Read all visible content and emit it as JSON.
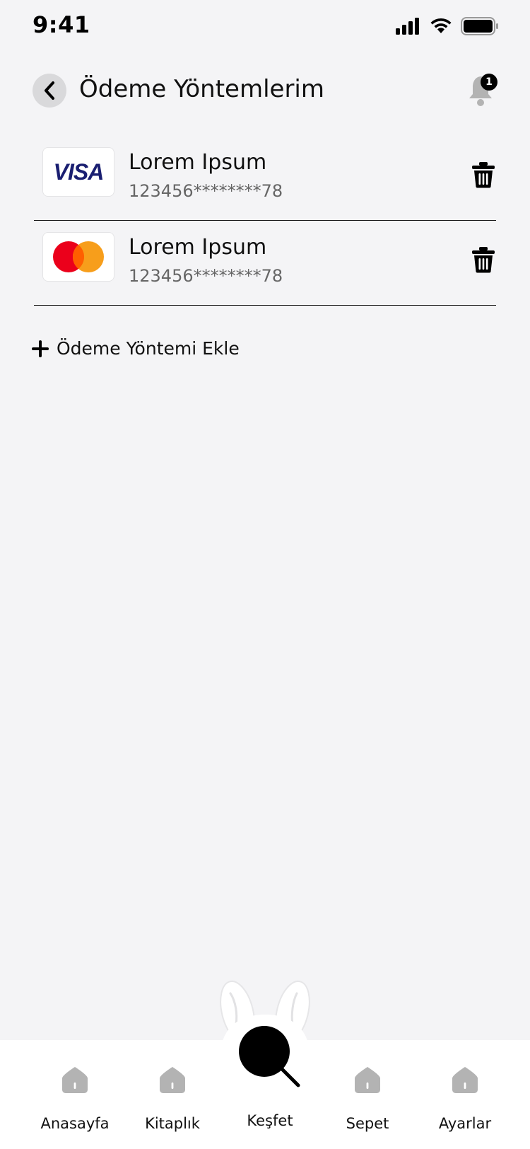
{
  "status_bar": {
    "time": "9:41"
  },
  "header": {
    "title": "Ödeme Yöntemlerim",
    "notification_count": "1"
  },
  "cards": [
    {
      "brand": "VISA",
      "name": "Lorem Ipsum",
      "number": "123456********78"
    },
    {
      "brand": "mastercard",
      "name": "Lorem Ipsum",
      "number": "123456********78"
    }
  ],
  "add_method": {
    "label": "Ödeme Yöntemi Ekle"
  },
  "tabbar": {
    "items": [
      {
        "label": "Anasayfa",
        "icon": "home-icon"
      },
      {
        "label": "Kitaplık",
        "icon": "home-icon"
      },
      {
        "label": "Keşfet",
        "icon": "search-icon"
      },
      {
        "label": "Sepet",
        "icon": "home-icon"
      },
      {
        "label": "Ayarlar",
        "icon": "home-icon"
      }
    ]
  },
  "colors": {
    "background": "#f4f4f6",
    "visa_blue": "#1a1f71",
    "mastercard_red": "#eb001b",
    "mastercard_orange": "#f79e1b",
    "icon_gray": "#b3b3b3"
  }
}
